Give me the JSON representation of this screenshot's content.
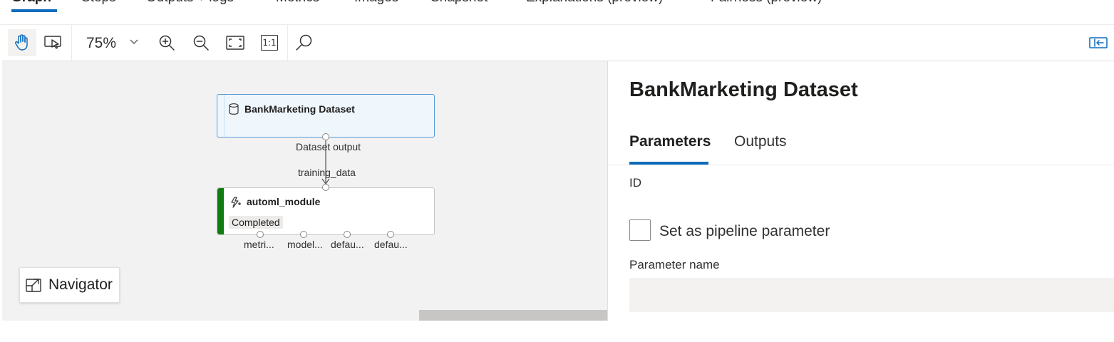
{
  "tabs": [
    {
      "label": "Graph",
      "active": true
    },
    {
      "label": "Steps"
    },
    {
      "label": "Outputs + logs"
    },
    {
      "label": "Metrics"
    },
    {
      "label": "Images"
    },
    {
      "label": "Snapshot"
    },
    {
      "label": "Explanations (preview)"
    },
    {
      "label": "Fairness (preview)"
    }
  ],
  "toolbar": {
    "zoom": "75%",
    "icons": [
      "hand-pan-icon",
      "select-pointer-icon",
      "zoom-in-icon",
      "zoom-out-icon",
      "fit-screen-icon",
      "actual-size-icon",
      "search-icon",
      "panel-toggle-icon"
    ],
    "actual_size_label": "1:1"
  },
  "graph": {
    "dataset_node": {
      "title": "BankMarketing Dataset",
      "output_label": "Dataset output",
      "icon": "database-icon"
    },
    "edge_input_label": "training_data",
    "module_node": {
      "title": "automl_module",
      "status": "Completed",
      "status_color": "#107c10",
      "icon": "automl-icon",
      "ports": [
        "metri...",
        "model...",
        "defau...",
        "defau..."
      ]
    },
    "navigator_label": "Navigator"
  },
  "panel": {
    "title": "BankMarketing Dataset",
    "tabs": [
      {
        "label": "Parameters",
        "active": true
      },
      {
        "label": "Outputs"
      }
    ],
    "id_label": "ID",
    "checkbox_label": "Set as pipeline parameter",
    "param_name_label": "Parameter name",
    "param_name_value": ""
  },
  "colors": {
    "accent": "#0f6cbd",
    "completed": "#107c10",
    "canvas_bg": "#f2f2f2"
  }
}
